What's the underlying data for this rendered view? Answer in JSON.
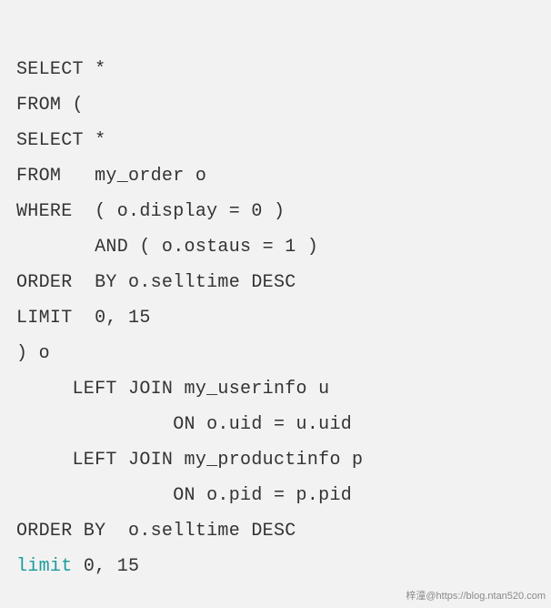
{
  "code": {
    "lines": [
      "SELECT *",
      "FROM (",
      "SELECT *",
      "FROM   my_order o",
      "WHERE  ( o.display = 0 )",
      "       AND ( o.ostaus = 1 )",
      "ORDER  BY o.selltime DESC",
      "LIMIT  0, 15",
      ") o",
      "     LEFT JOIN my_userinfo u",
      "              ON o.uid = u.uid",
      "     LEFT JOIN my_productinfo p",
      "              ON o.pid = p.pid",
      "ORDER BY  o.selltime DESC"
    ],
    "last_keyword": "limit",
    "last_rest": " 0, 15"
  },
  "watermark": "梓潼@https://blog.ntan520.com"
}
